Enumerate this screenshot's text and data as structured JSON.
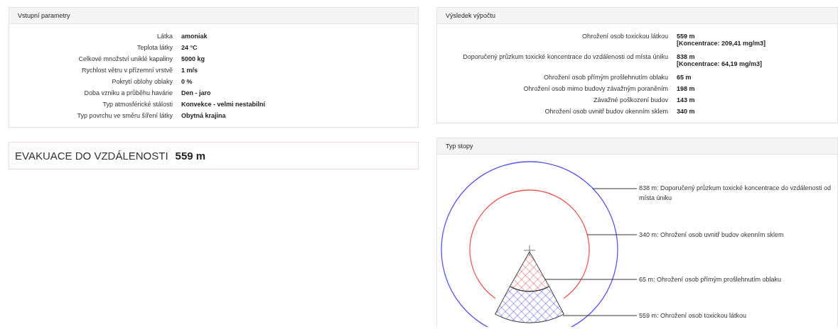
{
  "inputs": {
    "title": "Vstupní parametry",
    "rows": [
      {
        "label": "Látka",
        "value": "amoniak"
      },
      {
        "label": "Teplota látky",
        "value": "24 °C"
      },
      {
        "label": "Celkové množství uniklé kapaliny",
        "value": "5000 kg"
      },
      {
        "label": "Rychlost větru v přízemní vrstvě",
        "value": "1 m/s"
      },
      {
        "label": "Pokrytí oblohy oblaky",
        "value": "0 %"
      },
      {
        "label": "Doba vzniku a průběhu havárie",
        "value": "Den - jaro"
      },
      {
        "label": "Typ atmosférické stálosti",
        "value": "Konvekce - velmi nestabilní"
      },
      {
        "label": "Typ povrchu ve směru šíření látky",
        "value": "Obytná krajina"
      }
    ]
  },
  "evacuation": {
    "label": "EVAKUACE DO VZDÁLENOSTI",
    "value": "559 m"
  },
  "results": {
    "title": "Výsledek výpočtu",
    "rows": [
      {
        "label": "Ohrožení osob toxickou látkou",
        "value": "559 m",
        "note": "[Koncentrace: 209,41 mg/m3]"
      },
      {
        "label": "Doporučený průzkum toxické koncentrace do vzdálenosti od místa úniku",
        "value": "838 m",
        "note": "[Koncentrace: 64,19 mg/m3]"
      },
      {
        "label": "Ohrožení osob přímým prošlehnutím oblaku",
        "value": "65 m"
      },
      {
        "label": "Ohrožení osob mimo budovy závažným poraněním",
        "value": "198 m"
      },
      {
        "label": "Závažné poškození budov",
        "value": "143 m"
      },
      {
        "label": "Ohrožení osob uvnitř budov okenním sklem",
        "value": "340 m"
      }
    ]
  },
  "trace": {
    "title": "Typ stopy",
    "labels": [
      "838 m: Doporučený průzkum toxické koncentrace do vzdálenosti od místa úniku",
      "340 m: Ohrožení osob uvnitř budov okenním sklem",
      "65 m: Ohrožení osob přímým prošlehnutím oblaku",
      "559 m: Ohrožení osob toxickou látkou"
    ]
  }
}
